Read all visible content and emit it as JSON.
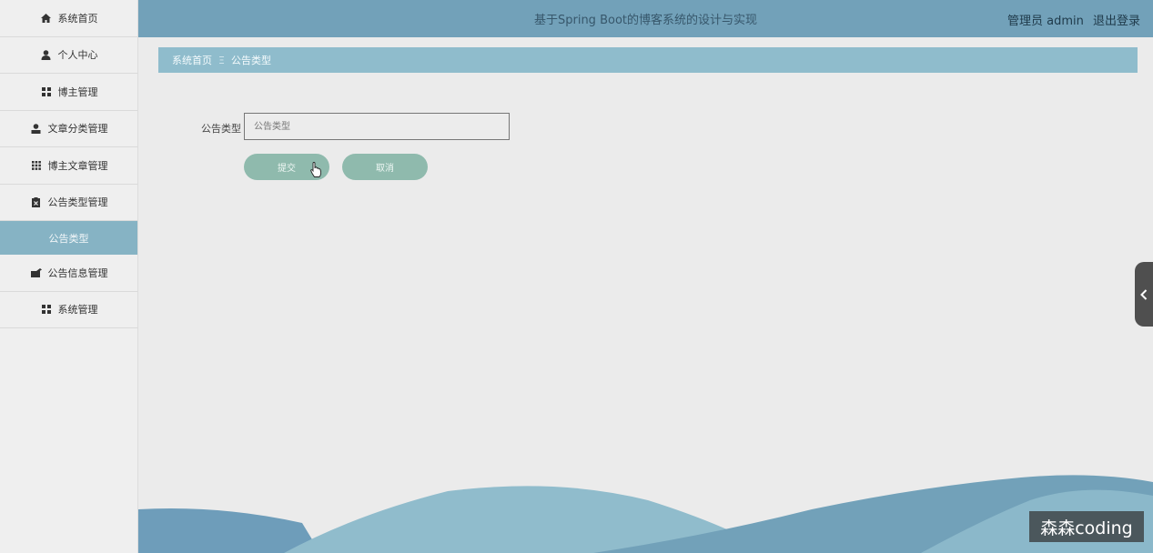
{
  "header": {
    "title": "基于Spring Boot的博客系统的设计与实现",
    "user": "管理员 admin",
    "logout": "退出登录"
  },
  "sidebar": {
    "items": [
      {
        "label": "系统首页",
        "icon": "home-icon"
      },
      {
        "label": "个人中心",
        "icon": "user-icon"
      },
      {
        "label": "博主管理",
        "icon": "grid-icon"
      },
      {
        "label": "文章分类管理",
        "icon": "person-icon"
      },
      {
        "label": "博主文章管理",
        "icon": "apps-icon"
      },
      {
        "label": "公告类型管理",
        "icon": "clipboard-icon"
      },
      {
        "label": "公告类型",
        "icon": "",
        "active": true
      },
      {
        "label": "公告信息管理",
        "icon": "briefcase-icon"
      },
      {
        "label": "系统管理",
        "icon": "grid-icon"
      }
    ]
  },
  "breadcrumb": {
    "home": "系统首页",
    "separator": "Ξ",
    "current": "公告类型"
  },
  "form": {
    "label": "公告类型",
    "placeholder": "公告类型",
    "value": "",
    "submit": "提交",
    "cancel": "取消"
  },
  "watermark": "森森coding",
  "colors": {
    "header": "#72a1b9",
    "breadcrumb": "#8fbccc",
    "active_menu": "#86b3c4",
    "button": "#8fbaad"
  }
}
